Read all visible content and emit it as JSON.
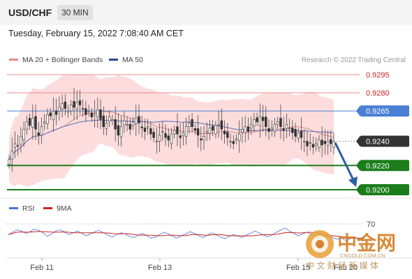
{
  "header": {
    "pair": "USD/CHF",
    "timeframe": "30 MIN"
  },
  "timestamp": "Tuesday, February 15, 2022 7:08:40 AM CET",
  "legend": {
    "ma20": "MA 20 + Bollinger Bands",
    "ma50": "MA 50",
    "copyright": "Research © 2022 Trading Central"
  },
  "rsi_legend": {
    "rsi": "RSI",
    "ma9": "9MA"
  },
  "rsi_level_label": "70",
  "x_tick_labels": [
    "Feb 11",
    "Feb 13",
    "Feb 15",
    "Feb 20"
  ],
  "watermark": {
    "name": "中金网",
    "sub": "中 文 财 经 新 媒 体",
    "url": "CNGOLD.COM.CN"
  },
  "colors": {
    "bb_fill": "#fbd6d6",
    "ma20": "#d98a8a",
    "ma50": "#5a6ab8",
    "pivot": "#4a7fd6",
    "support": "#1b7d1b",
    "resistance": "#e88a8a",
    "arrow": "#2a5fa8",
    "rsi": "#4a6fd6",
    "rsi_ma": "#cc2222",
    "current": "#333333"
  },
  "chart_data": {
    "type": "candlestick",
    "title": "USD/CHF",
    "x_ticks": [
      "Feb 11",
      "Feb 13",
      "Feb 15"
    ],
    "price_levels": [
      {
        "label": "0.9295",
        "value": 0.9295,
        "role": "resistance"
      },
      {
        "label": "0.9280",
        "value": 0.928,
        "role": "resistance"
      },
      {
        "label": "0.9265",
        "value": 0.9265,
        "role": "pivot"
      },
      {
        "label": "0.9240",
        "value": 0.924,
        "role": "current"
      },
      {
        "label": "0.9220",
        "value": 0.922,
        "role": "support"
      },
      {
        "label": "0.9200",
        "value": 0.92,
        "role": "support"
      }
    ],
    "y_range": [
      0.9197,
      0.93
    ],
    "closes": [
      0.9225,
      0.9232,
      0.9238,
      0.9236,
      0.9244,
      0.925,
      0.9256,
      0.9253,
      0.9259,
      0.925,
      0.9245,
      0.9252,
      0.9256,
      0.9262,
      0.9261,
      0.9265,
      0.9262,
      0.9268,
      0.9271,
      0.9267,
      0.9265,
      0.927,
      0.9268,
      0.9272,
      0.927,
      0.9267,
      0.9262,
      0.9265,
      0.926,
      0.9263,
      0.9266,
      0.9258,
      0.9252,
      0.9255,
      0.926,
      0.9258,
      0.925,
      0.9245,
      0.9252,
      0.9257,
      0.9254,
      0.925,
      0.9256,
      0.9259,
      0.9255,
      0.9251,
      0.9248,
      0.9252,
      0.9246,
      0.9243,
      0.924,
      0.9245,
      0.9248,
      0.9243,
      0.9241,
      0.9246,
      0.9249,
      0.9246,
      0.9243,
      0.9247,
      0.9252,
      0.9255,
      0.9252,
      0.9249,
      0.9245,
      0.9241,
      0.9244,
      0.9248,
      0.9251,
      0.9249,
      0.9253,
      0.9254,
      0.925,
      0.9246,
      0.9243,
      0.924,
      0.9238,
      0.9242,
      0.9246,
      0.925,
      0.9252,
      0.9248,
      0.9254,
      0.9258,
      0.9256,
      0.926,
      0.9257,
      0.9252,
      0.9248,
      0.9251,
      0.9254,
      0.9256,
      0.9252,
      0.9249,
      0.9254,
      0.9251,
      0.9247,
      0.9244,
      0.9247,
      0.9243,
      0.924,
      0.9236,
      0.9239,
      0.9235,
      0.9238,
      0.9241,
      0.9237,
      0.9238,
      0.924,
      0.9238,
      0.924
    ],
    "rsi": {
      "levels": [
        70
      ],
      "values": [
        52,
        56,
        60,
        58,
        54,
        57,
        61,
        59,
        55,
        49,
        53,
        58,
        60,
        56,
        52,
        55,
        58,
        54,
        50,
        53,
        57,
        59,
        55,
        51,
        48,
        52,
        55,
        53,
        49,
        47,
        51,
        54,
        50,
        46,
        48,
        52,
        56,
        53,
        49,
        46,
        50,
        53,
        57,
        54,
        50,
        47,
        51,
        55,
        52,
        48,
        45,
        49,
        52,
        50,
        47,
        51,
        54,
        58,
        55,
        51,
        48,
        52,
        56,
        60,
        63,
        58,
        54,
        50,
        53,
        56,
        52,
        48,
        45,
        48,
        51,
        47,
        44,
        46,
        42,
        45,
        48,
        44,
        41
      ]
    }
  }
}
